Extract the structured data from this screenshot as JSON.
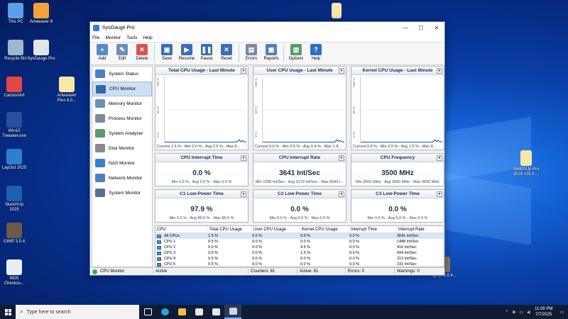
{
  "desktop": {
    "icons": [
      {
        "label": "This PC"
      },
      {
        "label": "Artweaver 8"
      },
      {
        "label": "Recycle Bin"
      },
      {
        "label": "SysGauge Pro"
      },
      {
        "label": "CartoonArt"
      },
      {
        "label": "Artweaver Plus 8.0..."
      },
      {
        "label": "Win10 Tweaker.exe"
      },
      {
        "label": "LayOut 2025"
      },
      {
        "label": "SketchUp 2025"
      },
      {
        "label": "GIMP 3.0.4"
      },
      {
        "label": "MD5 Checksu..."
      },
      {
        "label": "SketchUp Pro 2025 v25.0...."
      },
      {
        "label": "gimp-3.0.4..."
      }
    ]
  },
  "window": {
    "title": "SysGauge Pro",
    "controls": {
      "minimize": "—",
      "maximize": "☐",
      "close": "✕"
    },
    "menu": [
      "File",
      "Monitor",
      "Tools",
      "Help"
    ],
    "toolbar": [
      {
        "label": "Add",
        "glyph": "+",
        "color": "#5a8ac6"
      },
      {
        "label": "Edit",
        "glyph": "✎",
        "color": "#6c8fb5"
      },
      {
        "label": "Delete",
        "glyph": "✕",
        "color": "#d9534f"
      },
      {
        "label": "Save",
        "glyph": "▣",
        "color": "#3b6fb6"
      },
      {
        "label": "Resume",
        "glyph": "▶",
        "color": "#3b6fb6"
      },
      {
        "label": "Pause",
        "glyph": "❚❚",
        "color": "#3b6fb6"
      },
      {
        "label": "Reset",
        "glyph": "✕",
        "color": "#3b6fb6"
      },
      {
        "label": "Errors",
        "glyph": "▤",
        "color": "#7a8aa0"
      },
      {
        "label": "Reports",
        "glyph": "▦",
        "color": "#4f7fbf"
      },
      {
        "label": "Options",
        "glyph": "▥",
        "color": "#5a9a6a"
      },
      {
        "label": "Help",
        "glyph": "?",
        "color": "#2f6fbf"
      }
    ],
    "sidebar": [
      {
        "label": "System Status",
        "active": false
      },
      {
        "label": "CPU Monitor",
        "active": true
      },
      {
        "label": "Memory Monitor",
        "active": false
      },
      {
        "label": "Process Monitor",
        "active": false
      },
      {
        "label": "System Analyzer",
        "active": false
      },
      {
        "label": "Disk Monitor",
        "active": false
      },
      {
        "label": "NAS Monitor",
        "active": false
      },
      {
        "label": "Network Monitor",
        "active": false
      },
      {
        "label": "System Monitor",
        "active": false
      }
    ],
    "charts": [
      {
        "title": "Total CPU Usage - Last Minute",
        "y_ticks": [
          "100 %",
          "50 %",
          "0 %"
        ],
        "footer": "Current 1.5 % - Min 0.0 % - Avg 2.5 % - Max 6..."
      },
      {
        "title": "User CPU Usage - Last Minute",
        "y_ticks": [
          "100 %",
          "50 %",
          "0 %"
        ],
        "footer": "Current 0.0 % - Min 0.0 % - Avg 0.4 % - Max 1.8..."
      },
      {
        "title": "Kernel CPU Usage - Last Minute",
        "y_ticks": [
          "100 %",
          "50 %",
          "0 %"
        ],
        "footer": "Current 0.9 % - Min 0.0 % - Avg 1.5 % - Max 4..."
      }
    ],
    "stats": [
      {
        "title": "CPU Interrupt Time",
        "value": "0.0 %",
        "footer": "Min 0.0 % - Avg 0.0 % - Max 0.0 %"
      },
      {
        "title": "CPU Interrupt Rate",
        "value": "3641 Int/Sec",
        "footer": "Min 1585 Int/Sec - Avg 3179 Int/Sec - Max 6545 I..."
      },
      {
        "title": "CPU Frequency",
        "value": "3500 MHz",
        "footer": "Min 3500 MHz - Avg 3500 MHz - Max 3500 MHz"
      },
      {
        "title": "C1 Low-Power Time",
        "value": "97.9 %",
        "footer": "Min 0.0 % - Avg 85.8 % - Max 99.6 %"
      },
      {
        "title": "C2 Low-Power Time",
        "value": "0.0 %",
        "footer": "Min 0.0 % - Avg 0.0 % - Max 0.0 %"
      },
      {
        "title": "C3 Low-Power Time",
        "value": "0.0 %",
        "footer": "Min 0.0 % - Avg 0.0 % - Max 0.0 %"
      }
    ],
    "table": {
      "columns": [
        "CPU",
        "Total CPU Usage",
        "User CPU Usage",
        "Kernel CPU Usage",
        "Interrupt Time",
        "Interrupt Rate"
      ],
      "rows": [
        [
          "All CPUs",
          "1.5 %",
          "0.0 %",
          "0.9 %",
          "0.0 %",
          "3641 Int/Sec"
        ],
        [
          "CPU 1",
          "0.5 %",
          "0.0 %",
          "0.0 %",
          "0.0 %",
          "1488 Int/Sec"
        ],
        [
          "CPU 2",
          "5.0 %",
          "0.0 %",
          "4.5 %",
          "0.0 %",
          "416 Int/Sec"
        ],
        [
          "CPU 3",
          "2.0 %",
          "0.0 %",
          "1.5 %",
          "0.0 %",
          "434 Int/Sec"
        ],
        [
          "CPU 4",
          "0.5 %",
          "0.0 %",
          "0.0 %",
          "0.0 %",
          "213 Int/Sec"
        ],
        [
          "CPU 5",
          "0.5 %",
          "0.0 %",
          "0.0 %",
          "0.0 %",
          "231 Int/Sec"
        ]
      ]
    },
    "status": {
      "monitor": "CPU Monitor",
      "state": "Active",
      "counters": "Counters: 81",
      "active": "Active: 81",
      "errors": "Errors: 0",
      "warnings": "Warnings: 0"
    }
  },
  "taskbar": {
    "search_placeholder": "Type here to search",
    "time": "11:09 PM",
    "date": "7/7/2025"
  }
}
